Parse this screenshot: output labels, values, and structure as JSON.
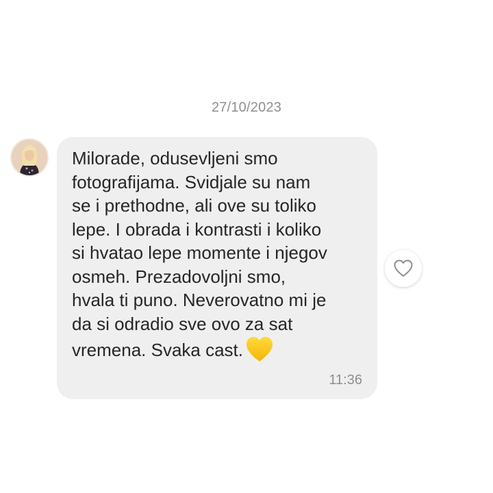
{
  "chat": {
    "date_divider": "27/10/2023",
    "message": {
      "text": "Milorade, odusevljeni smo\nfotografijama. Svidjale su nam\nse i prethodne, ali ove su toliko\nlepe. I obrada i kontrasti i koliko\nsi hvatao lepe momente i njegov\nosmeh. Prezadovoljni smo,\nhvala ti puno. Neverovatno mi je\nda si odradio sve ovo za sat\nvremena. Svaka cast.",
      "emoji": "yellow-heart-icon",
      "time": "11:36"
    },
    "like_icon": "heart-outline-icon"
  },
  "colors": {
    "bubble": "#efefef",
    "text": "#262626",
    "meta": "#8e8e8e",
    "emoji_heart": "#f7c417"
  }
}
